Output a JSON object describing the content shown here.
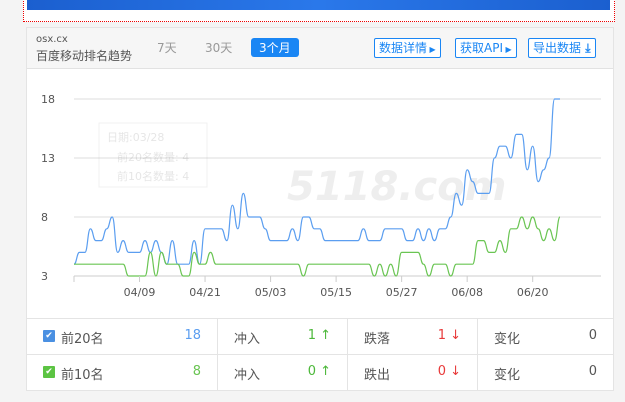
{
  "header": {
    "domain": "osx.cx",
    "title": "百度移动排名趋势",
    "ranges": [
      "7天",
      "30天",
      "3个月"
    ],
    "active_range": "3个月",
    "buttons": [
      "数据详情",
      "获取API",
      "导出数据"
    ]
  },
  "tooltip": {
    "date": "日期:03/28",
    "top20": "前20名数量: 4",
    "top10": "前10名数量: 4"
  },
  "watermark": "5118.com",
  "colors": {
    "accent": "#1a86f4",
    "top20": "#5b9ef0",
    "top10": "#6ac553",
    "up": "#4cb83a",
    "down": "#e83a3a"
  },
  "chart_data": {
    "type": "line",
    "ylim": [
      3,
      18
    ],
    "yticks": [
      "18",
      "13",
      "8",
      "3"
    ],
    "xticks": [
      "04/09",
      "04/21",
      "05/03",
      "05/15",
      "05/27",
      "06/08",
      "06/20"
    ],
    "grid": true,
    "series": [
      {
        "values": [
          4,
          5,
          5,
          7,
          6,
          6,
          7,
          8,
          5,
          6,
          5,
          5,
          5,
          6,
          5,
          6,
          5,
          4,
          6,
          4,
          4,
          4,
          6,
          4,
          7,
          7,
          7,
          7,
          6,
          9,
          7,
          10,
          8,
          8,
          8,
          7,
          6,
          6,
          6,
          6,
          7,
          6,
          8,
          8,
          7,
          7,
          6,
          6,
          6,
          6,
          6,
          6,
          6,
          7,
          6,
          6,
          6,
          7,
          7,
          7,
          7,
          6,
          6,
          7,
          6,
          7,
          6,
          7,
          7,
          8,
          10,
          9,
          12,
          11,
          10,
          10,
          10,
          13,
          14,
          14,
          13,
          15,
          15,
          12,
          14,
          11,
          12,
          13,
          18,
          18
        ]
      },
      {
        "values": [
          4,
          4,
          4,
          4,
          4,
          4,
          4,
          4,
          4,
          4,
          3,
          3,
          3,
          3,
          5,
          3,
          5,
          4,
          4,
          4,
          3,
          3,
          5,
          4,
          4,
          5,
          4,
          4,
          4,
          4,
          4,
          4,
          4,
          4,
          4,
          4,
          4,
          4,
          4,
          4,
          4,
          4,
          3,
          4,
          4,
          4,
          4,
          4,
          4,
          4,
          4,
          4,
          4,
          4,
          4,
          3,
          4,
          3,
          4,
          3,
          5,
          5,
          5,
          5,
          4,
          3,
          4,
          4,
          4,
          3,
          4,
          4,
          4,
          4,
          6,
          6,
          5,
          5,
          6,
          5,
          7,
          7,
          8,
          7,
          8,
          7,
          6,
          7,
          6,
          8
        ]
      }
    ]
  },
  "stats": [
    {
      "label": "前20名",
      "value": "18",
      "in_label": "冲入",
      "in_value": "1",
      "out_label": "跌落",
      "out_value": "1",
      "change_label": "变化",
      "change_value": "0"
    },
    {
      "label": "前10名",
      "value": "8",
      "in_label": "冲入",
      "in_value": "0",
      "out_label": "跌出",
      "out_value": "0",
      "change_label": "变化",
      "change_value": "0"
    }
  ]
}
